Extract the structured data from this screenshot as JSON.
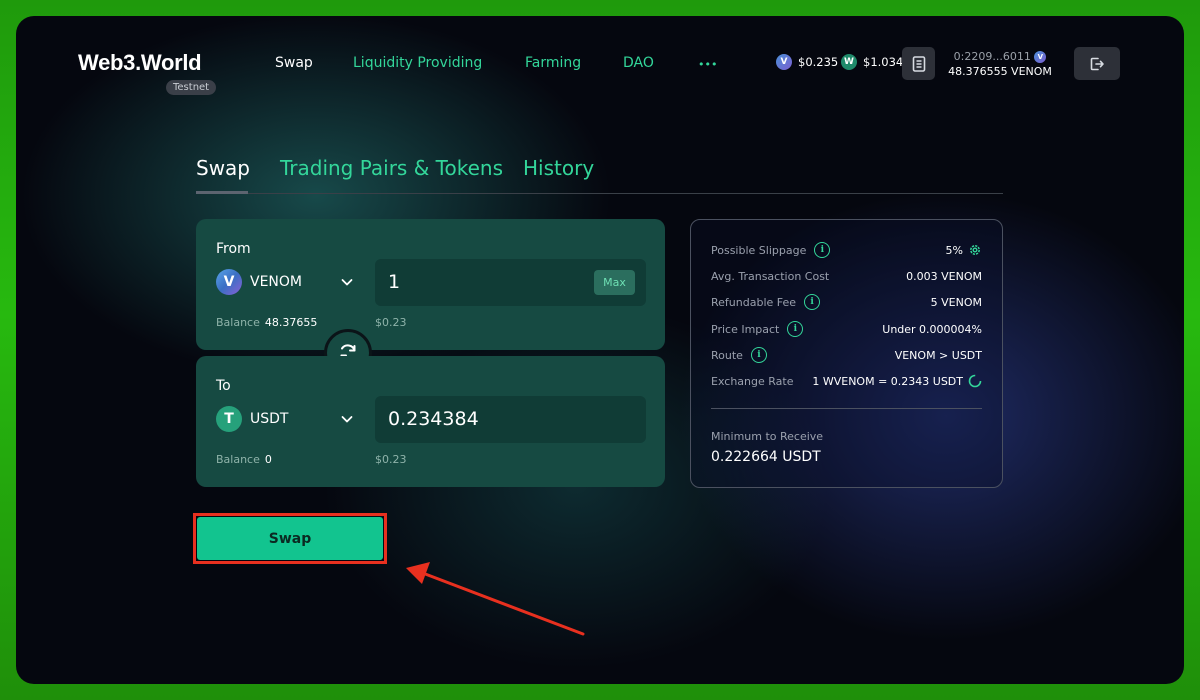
{
  "header": {
    "logo": "Web3.World",
    "network_badge": "Testnet",
    "nav": [
      {
        "label": "Swap"
      },
      {
        "label": "Liquidity Providing"
      },
      {
        "label": "Farming"
      },
      {
        "label": "DAO"
      },
      {
        "label": "•••"
      }
    ],
    "prices": [
      {
        "icon": "venom-token-icon",
        "value": "$0.235"
      },
      {
        "icon": "wvenom-token-icon",
        "value": "$1.034"
      }
    ],
    "wallet": {
      "address": "0:2209...6011",
      "balance": "48.376555 VENOM"
    }
  },
  "tabs": [
    {
      "label": "Swap"
    },
    {
      "label": "Trading Pairs & Tokens"
    },
    {
      "label": "History"
    }
  ],
  "from": {
    "label": "From",
    "token": "VENOM",
    "amount": "1",
    "max_label": "Max",
    "balance_label": "Balance",
    "balance_value": "48.37655",
    "usd_value": "$0.23"
  },
  "to": {
    "label": "To",
    "token": "USDT",
    "amount": "0.234384",
    "balance_label": "Balance",
    "balance_value": "0",
    "usd_value": "$0.23"
  },
  "info": {
    "rows": [
      {
        "key": "Possible Slippage",
        "value": "5%"
      },
      {
        "key": "Avg. Transaction Cost",
        "value": "0.003 VENOM"
      },
      {
        "key": "Refundable Fee",
        "value": "5 VENOM"
      },
      {
        "key": "Price Impact",
        "value": "Under 0.000004%"
      },
      {
        "key": "Route",
        "value": "VENOM > USDT"
      },
      {
        "key": "Exchange Rate",
        "value": "1 WVENOM = 0.2343 USDT"
      }
    ],
    "min_receive_label": "Minimum to Receive",
    "min_receive_value": "0.222664 USDT"
  },
  "swap_button": {
    "label": "Swap"
  },
  "colors": {
    "accent": "#33d69a",
    "button": "#12c48f",
    "highlight": "#e8301f"
  }
}
